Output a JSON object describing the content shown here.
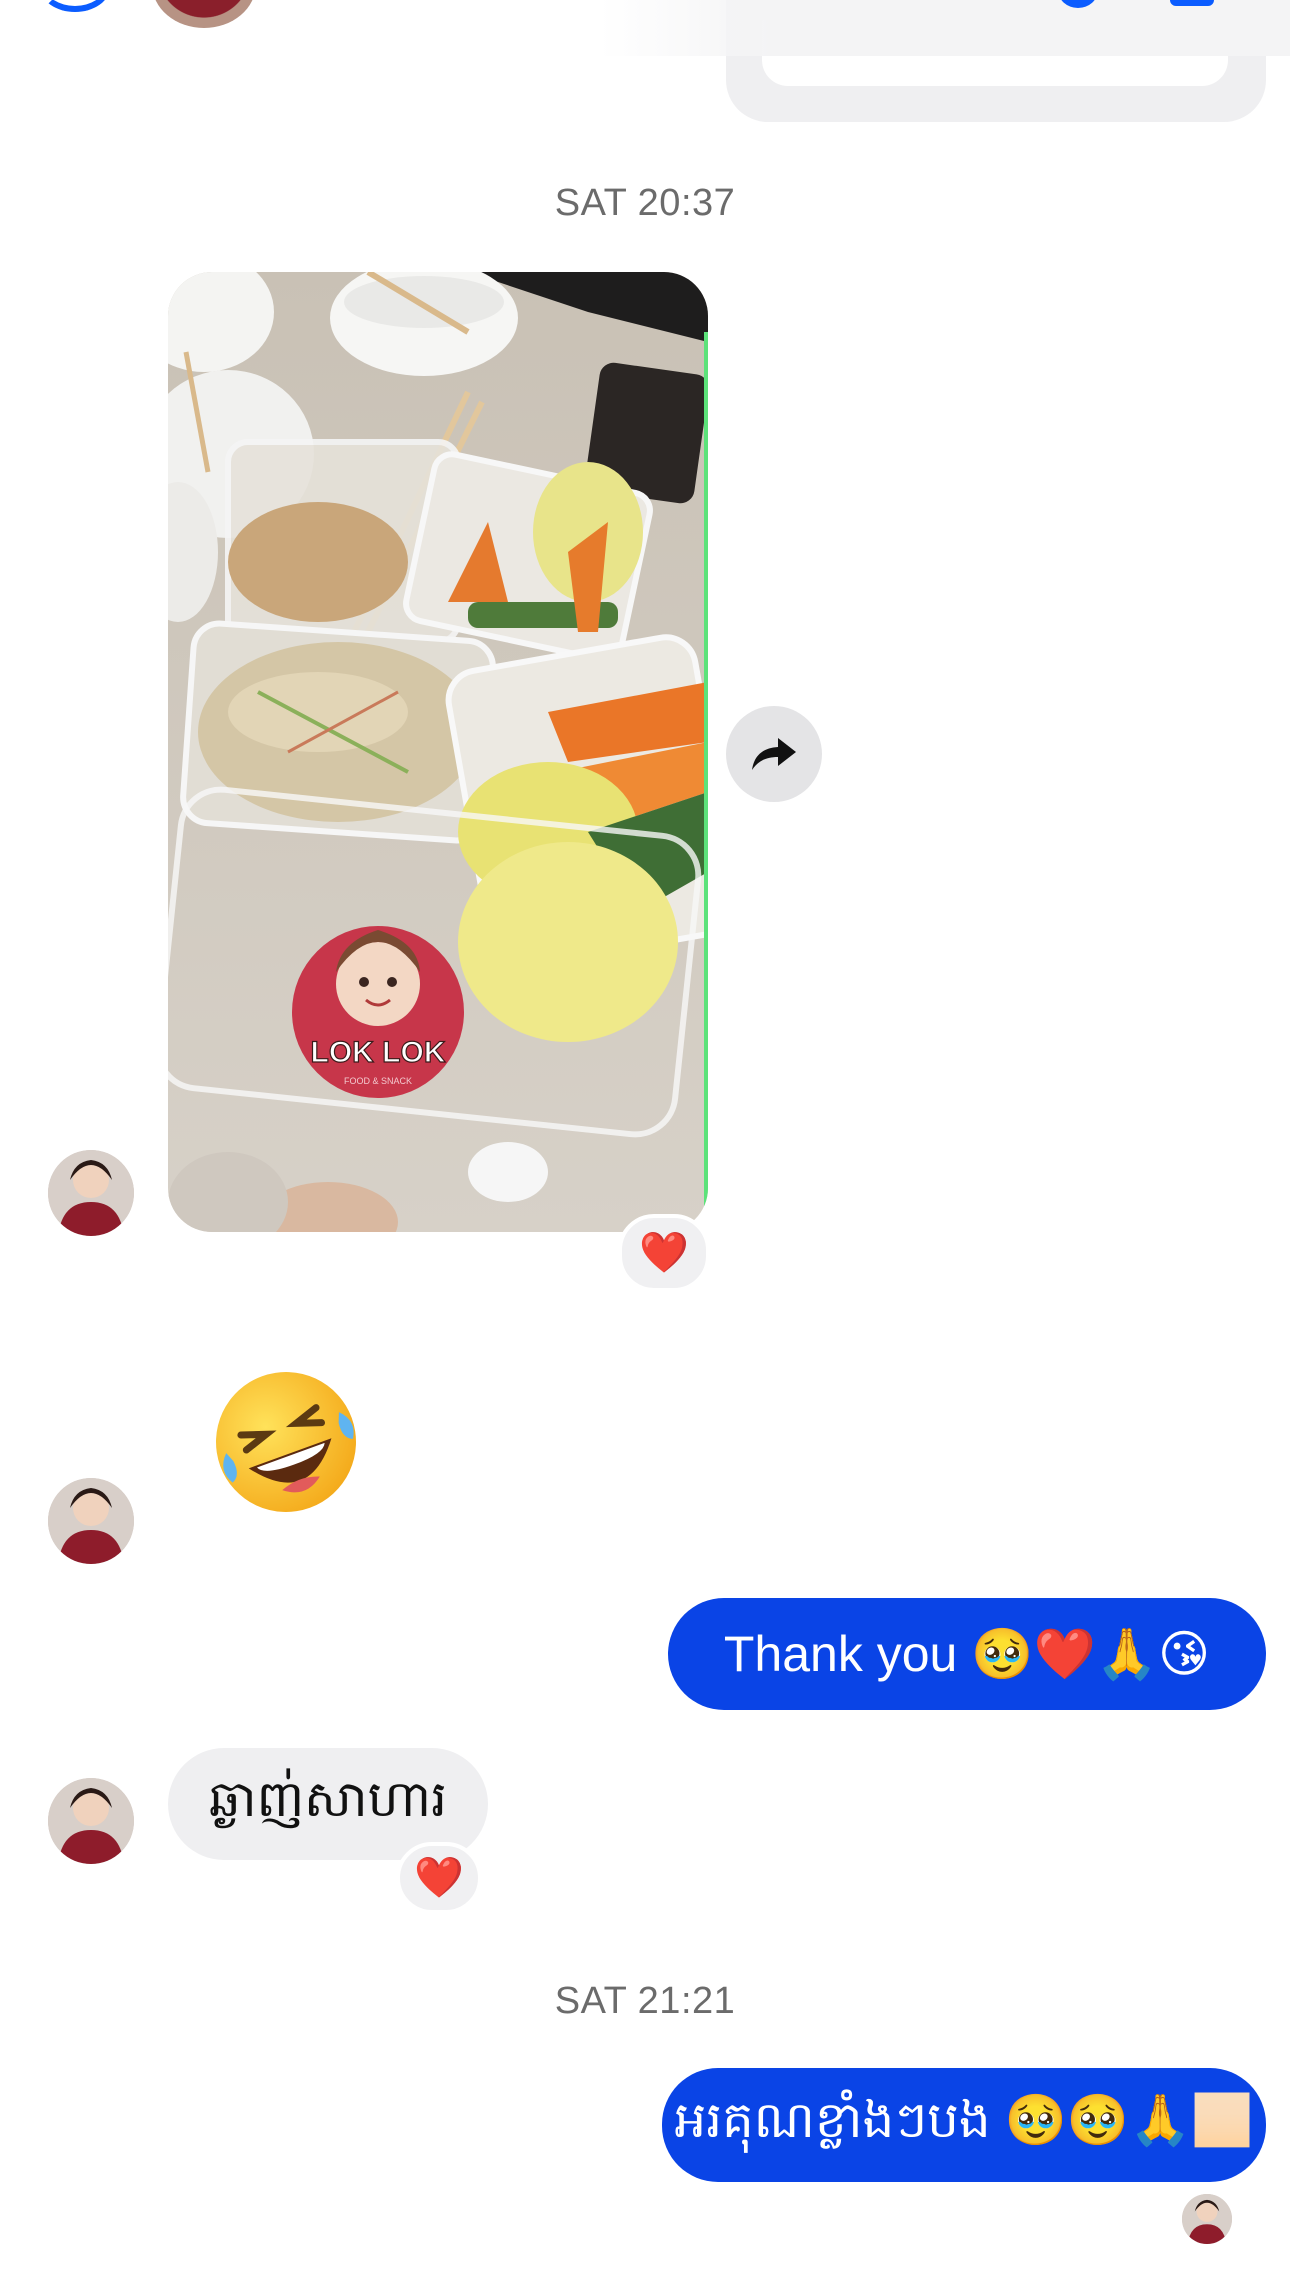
{
  "conversation": {
    "timestamps": [
      "SAT 20:37",
      "SAT 21:21"
    ],
    "photo_message": {
      "sticker_text": "LOK LOK",
      "sticker_subtext": "FOOD & SNACK",
      "reaction": "❤️"
    },
    "big_emoji": "🤣",
    "messages": [
      {
        "direction": "sent",
        "text": "Thank you 🥹❤️🙏😘"
      },
      {
        "direction": "received",
        "text": "ឆ្ងាញ់សាហារ",
        "reaction": "❤️"
      },
      {
        "direction": "sent",
        "text": "អរគុណខ្លាំងៗបង 🥹🥹🙏🏻"
      }
    ]
  },
  "icons": {
    "share": "share-forward-icon",
    "heart": "heart-icon"
  },
  "colors": {
    "sent_bubble": "#0a44e6",
    "received_bubble": "#efeff1",
    "timestamp_text": "#6b6b6b",
    "reaction_heart": "#e0162b"
  }
}
